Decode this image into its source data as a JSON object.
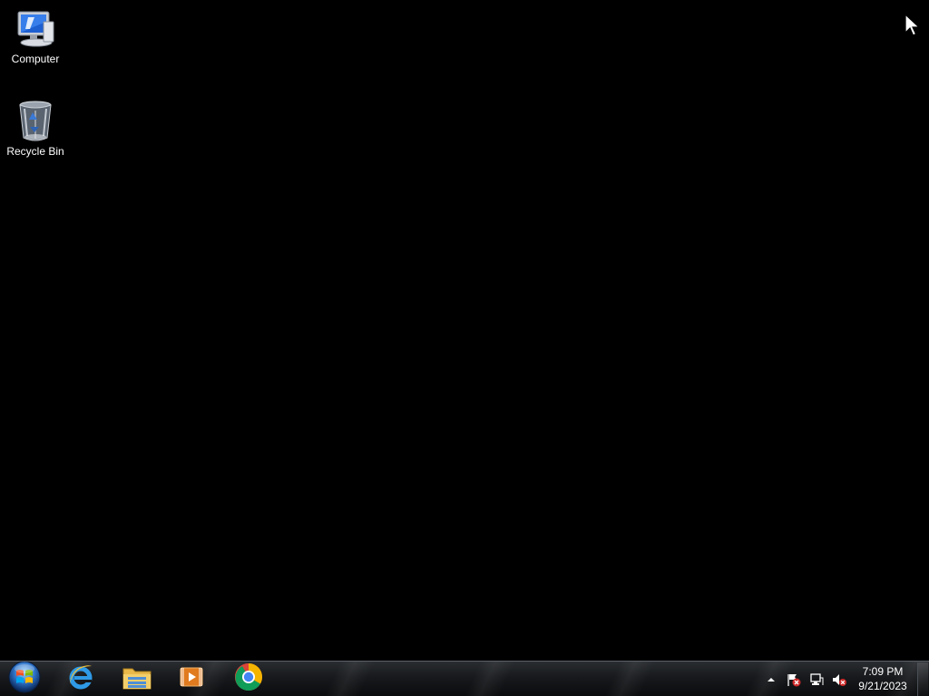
{
  "desktop": {
    "icons": [
      {
        "label": "Computer",
        "icon": "computer-icon"
      },
      {
        "label": "Recycle Bin",
        "icon": "recycle-bin-icon"
      }
    ]
  },
  "taskbar": {
    "start_icon": "windows-start-orb-icon",
    "pinned_apps": [
      {
        "icon": "internet-explorer-icon"
      },
      {
        "icon": "file-explorer-icon"
      },
      {
        "icon": "media-player-icon"
      },
      {
        "icon": "chrome-icon"
      }
    ],
    "tray": {
      "icons": [
        "show-hidden-icons-arrow-icon",
        "action-center-flag-icon",
        "network-icon",
        "volume-muted-icon"
      ],
      "time": "7:09 PM",
      "date": "9/21/2023"
    }
  },
  "colors": {
    "desktop_background": "#000000",
    "label_text": "#ffffff"
  }
}
